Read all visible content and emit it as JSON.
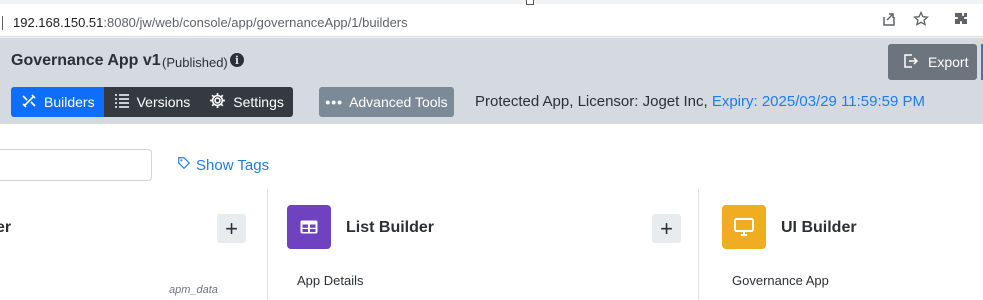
{
  "browser": {
    "url_host": "192.168.150.51",
    "url_rest": ":8080/jw/web/console/app/governanceApp/1/builders",
    "icons": [
      "share-icon",
      "star-icon",
      "extensions-icon"
    ]
  },
  "header": {
    "app_title": "Governance App v1",
    "status": "(Published)",
    "export_label": "Export",
    "tabs": [
      {
        "label": "Builders",
        "icon": "builders-icon",
        "active": true
      },
      {
        "label": "Versions",
        "icon": "versions-icon",
        "active": false
      },
      {
        "label": "Settings",
        "icon": "gear-icon",
        "active": false
      }
    ],
    "advanced_tools_label": "Advanced Tools",
    "license_text": "Protected App, Licensor: Joget Inc,",
    "expiry_text": "Expiry: 2025/03/29 11:59:59 PM"
  },
  "toolbar": {
    "show_tags_label": "Show Tags"
  },
  "cards": [
    {
      "name_partial": "er",
      "subtitle": "apm_data"
    },
    {
      "name": "List Builder",
      "subtitle": "App Details",
      "color": "#6f42c1"
    },
    {
      "name": "UI Builder",
      "subtitle": "Governance App",
      "color": "#f0ad22"
    }
  ],
  "colors": {
    "accent": "#0d6efd",
    "header_bg": "#d4dae0",
    "link": "#1e7ee8"
  }
}
